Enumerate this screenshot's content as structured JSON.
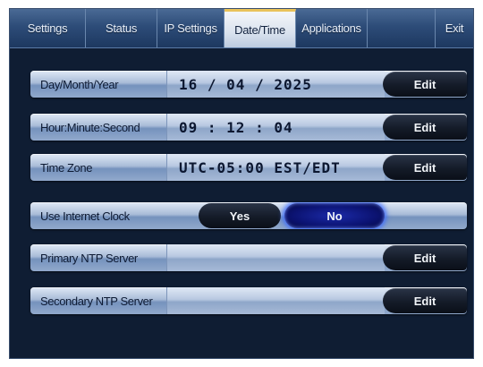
{
  "tabs": [
    {
      "label": "Settings",
      "active": false
    },
    {
      "label": "Status",
      "active": false
    },
    {
      "label": "IP Settings",
      "active": false
    },
    {
      "label": "Date/Time",
      "active": true
    },
    {
      "label": "Applications",
      "active": false
    },
    {
      "label": "",
      "active": false
    },
    {
      "label": "Exit",
      "active": false
    }
  ],
  "rows": {
    "date": {
      "label": "Day/Month/Year",
      "value": "16 / 04 / 2025",
      "button": "Edit"
    },
    "time": {
      "label": "Hour:Minute:Second",
      "value": "09 : 12 : 04",
      "button": "Edit"
    },
    "timezone": {
      "label": "Time Zone",
      "value": "UTC-05:00 EST/EDT",
      "button": "Edit"
    },
    "internet_clock": {
      "label": "Use Internet Clock",
      "yes": "Yes",
      "no": "No",
      "selected": "No"
    },
    "primary_ntp": {
      "label": "Primary NTP Server",
      "value": "",
      "button": "Edit"
    },
    "secondary_ntp": {
      "label": "Secondary NTP Server",
      "value": "",
      "button": "Edit"
    }
  },
  "colors": {
    "background": "#0f1d33",
    "active_tab_accent": "#e9c259",
    "selected_toggle": "#0b1270"
  }
}
